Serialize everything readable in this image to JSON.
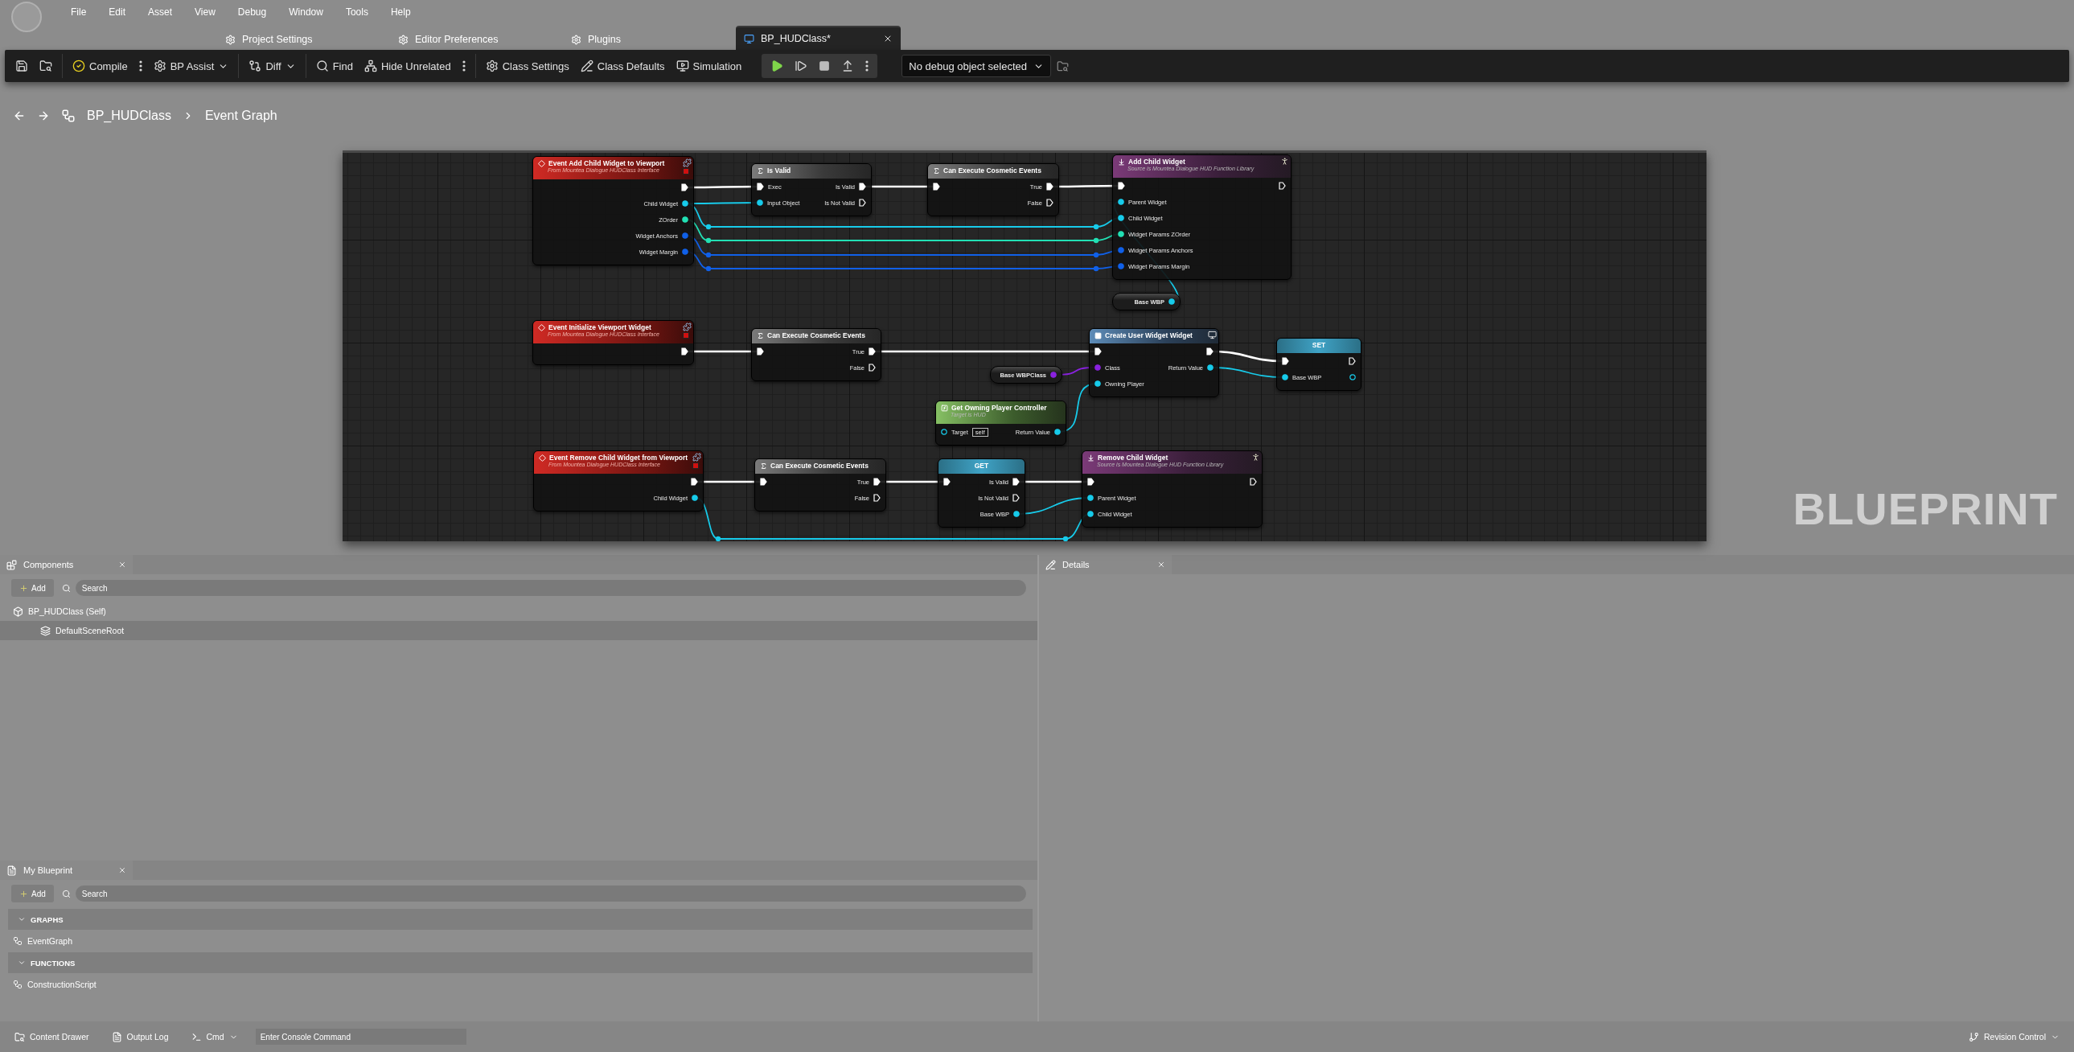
{
  "menu_bar": {
    "items": [
      "File",
      "Edit",
      "Asset",
      "View",
      "Debug",
      "Window",
      "Tools",
      "Help"
    ]
  },
  "document_tabs": [
    {
      "label": "Project Settings",
      "selected": false
    },
    {
      "label": "Editor Preferences",
      "selected": false
    },
    {
      "label": "Plugins",
      "selected": false
    },
    {
      "label": "BP_HUDClass*",
      "selected": true
    }
  ],
  "toolbar": {
    "compile": "Compile",
    "bp_assist": "BP Assist",
    "diff": "Diff",
    "find": "Find",
    "hide_unrelated": "Hide Unrelated",
    "class_settings": "Class Settings",
    "class_defaults": "Class Defaults",
    "simulation": "Simulation",
    "debug_filter": "No debug object selected"
  },
  "breadcrumb": [
    "BP_HUDClass",
    "Event Graph"
  ],
  "graph": {
    "label": "BLUEPRINT",
    "nodes": [
      {
        "kind": "event",
        "title": "Event Add Child Widget to Viewport",
        "subtitle": "From Mountea Dialogue HUDClass Interface",
        "outputs": [
          {
            "kind": "exec",
            "connected": true
          },
          {
            "kind": "object",
            "label": "Child Widget",
            "connected": true
          },
          {
            "kind": "int",
            "label": "ZOrder",
            "connected": true
          },
          {
            "kind": "struct",
            "label": "Widget Anchors",
            "connected": true
          },
          {
            "kind": "struct",
            "label": "Widget Margin",
            "connected": true
          }
        ]
      },
      {
        "kind": "macro",
        "title": "Is Valid",
        "inputs": [
          {
            "kind": "exec",
            "label": "Exec",
            "connected": true
          },
          {
            "kind": "object",
            "label": "Input Object",
            "connected": true
          }
        ],
        "outputs": [
          {
            "kind": "exec",
            "label": "Is Valid",
            "connected": true
          },
          {
            "kind": "exec",
            "label": "Is Not Valid",
            "connected": false
          }
        ]
      },
      {
        "kind": "macro",
        "title": "Can Execute Cosmetic Events",
        "inputs": [
          {
            "kind": "exec",
            "connected": true
          }
        ],
        "outputs": [
          {
            "kind": "exec",
            "label": "True",
            "connected": true
          },
          {
            "kind": "exec",
            "label": "False",
            "connected": false
          }
        ]
      },
      {
        "kind": "library",
        "title": "Add Child Widget",
        "subtitle": "Source is Mountea Dialogue HUD Function Library",
        "inputs": [
          {
            "kind": "exec",
            "connected": true
          },
          {
            "kind": "object",
            "label": "Parent Widget",
            "connected": true
          },
          {
            "kind": "object",
            "label": "Child Widget",
            "connected": true
          },
          {
            "kind": "int",
            "label": "Widget Params ZOrder",
            "connected": true
          },
          {
            "kind": "struct",
            "label": "Widget Params Anchors",
            "connected": true
          },
          {
            "kind": "struct",
            "label": "Widget Params Margin",
            "connected": true
          }
        ],
        "outputs": [
          {
            "kind": "exec",
            "connected": false
          }
        ]
      },
      {
        "kind": "variable",
        "outputs": [
          {
            "kind": "object",
            "label": "Base WBP",
            "connected": true
          }
        ]
      },
      {
        "kind": "event",
        "title": "Event Initialize Viewport Widget",
        "subtitle": "From Mountea Dialogue HUDClass Interface",
        "outputs": [
          {
            "kind": "exec",
            "connected": true
          }
        ]
      },
      {
        "kind": "macro",
        "title": "Can Execute Cosmetic Events",
        "inputs": [
          {
            "kind": "exec",
            "connected": true
          }
        ],
        "outputs": [
          {
            "kind": "exec",
            "label": "True",
            "connected": true
          },
          {
            "kind": "exec",
            "label": "False",
            "connected": false
          }
        ]
      },
      {
        "kind": "function",
        "title": "Create User Widget Widget",
        "inputs": [
          {
            "kind": "exec",
            "connected": true
          },
          {
            "kind": "class",
            "label": "Class",
            "connected": true
          },
          {
            "kind": "object",
            "label": "Owning Player",
            "connected": true
          }
        ],
        "outputs": [
          {
            "kind": "exec",
            "connected": true
          },
          {
            "kind": "object",
            "label": "Return Value",
            "connected": true
          }
        ]
      },
      {
        "kind": "variable",
        "outputs": [
          {
            "kind": "class",
            "label": "Base WBPClass",
            "connected": true
          }
        ]
      },
      {
        "kind": "pure",
        "title": "Get Owning Player Controller",
        "subtitle": "Target is HUD",
        "inputs": [
          {
            "kind": "object",
            "label": "Target",
            "connected": false,
            "value": "self"
          }
        ],
        "outputs": [
          {
            "kind": "object",
            "label": "Return Value",
            "connected": true
          }
        ]
      },
      {
        "kind": "setter",
        "title": "SET",
        "inputs": [
          {
            "kind": "exec",
            "connected": true
          },
          {
            "kind": "object",
            "label": "Base WBP",
            "connected": true
          }
        ],
        "outputs": [
          {
            "kind": "exec",
            "connected": false
          },
          {
            "kind": "object",
            "connected": false
          }
        ]
      },
      {
        "kind": "event",
        "title": "Event Remove Child Widget from Viewport",
        "subtitle": "From Mountea Dialogue HUDClass Interface",
        "outputs": [
          {
            "kind": "exec",
            "connected": true
          },
          {
            "kind": "object",
            "label": "Child Widget",
            "connected": true
          }
        ]
      },
      {
        "kind": "macro",
        "title": "Can Execute Cosmetic Events",
        "inputs": [
          {
            "kind": "exec",
            "connected": true
          }
        ],
        "outputs": [
          {
            "kind": "exec",
            "label": "True",
            "connected": true
          },
          {
            "kind": "exec",
            "label": "False",
            "connected": false
          }
        ]
      },
      {
        "kind": "getter",
        "title": "GET",
        "inputs": [
          {
            "kind": "exec",
            "connected": true
          }
        ],
        "outputs": [
          {
            "kind": "exec",
            "label": "Is Valid",
            "connected": true
          },
          {
            "kind": "exec",
            "label": "Is Not Valid",
            "connected": false
          },
          {
            "kind": "object",
            "label": "Base WBP",
            "connected": true
          }
        ]
      },
      {
        "kind": "library",
        "title": "Remove Child Widget",
        "subtitle": "Source is Mountea Dialogue HUD Function Library",
        "inputs": [
          {
            "kind": "exec",
            "connected": true
          },
          {
            "kind": "object",
            "label": "Parent Widget",
            "connected": true
          },
          {
            "kind": "object",
            "label": "Child Widget",
            "connected": true
          }
        ],
        "outputs": [
          {
            "kind": "exec",
            "connected": false
          }
        ]
      }
    ]
  },
  "components_panel": {
    "title": "Components",
    "add": "Add",
    "search": {
      "placeholder": "Search"
    },
    "tree": [
      {
        "label": "BP_HUDClass (Self)",
        "children": [
          {
            "label": "DefaultSceneRoot"
          }
        ]
      }
    ]
  },
  "my_blueprint_panel": {
    "title": "My Blueprint",
    "add": "Add",
    "search": {
      "placeholder": "Search"
    },
    "sections": [
      {
        "title": "GRAPHS",
        "items": [
          "EventGraph"
        ]
      },
      {
        "title": "FUNCTIONS",
        "items": [
          "ConstructionScript"
        ]
      }
    ]
  },
  "details_panel": {
    "title": "Details"
  },
  "status_bar": {
    "content_drawer": "Content Drawer",
    "output_log": "Output Log",
    "cmd": "Cmd",
    "console": {
      "placeholder": "Enter Console Command"
    },
    "revision_control": "Revision Control"
  }
}
